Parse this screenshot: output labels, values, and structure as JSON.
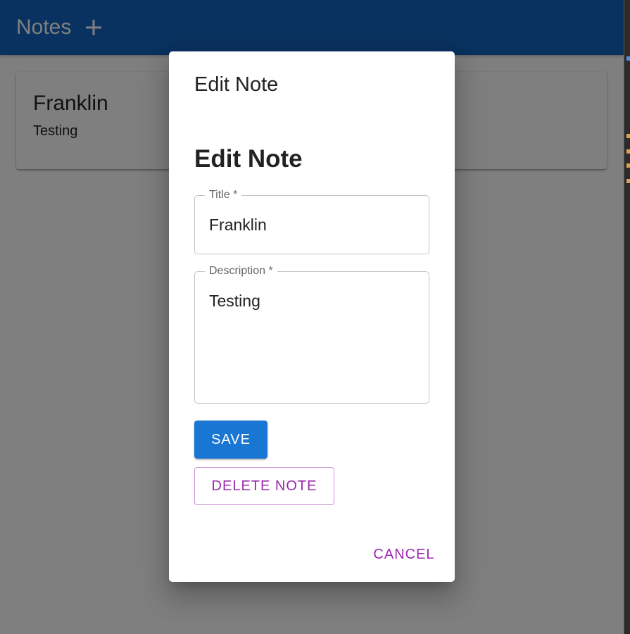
{
  "app_bar": {
    "title": "Notes",
    "add_icon": "plus-icon",
    "color": "#1565c0"
  },
  "notes": [
    {
      "title": "Franklin",
      "description": "Testing"
    }
  ],
  "dialog": {
    "title": "Edit Note",
    "form_heading": "Edit Note",
    "fields": {
      "title": {
        "label": "Title *",
        "value": "Franklin"
      },
      "description": {
        "label": "Description *",
        "value": "Testing"
      }
    },
    "buttons": {
      "save": "SAVE",
      "delete": "DELETE NOTE",
      "cancel": "CANCEL"
    }
  },
  "colors": {
    "primary": "#1976d2",
    "secondary": "#9c27b0",
    "backdrop": "rgba(0,0,0,0.5)"
  }
}
